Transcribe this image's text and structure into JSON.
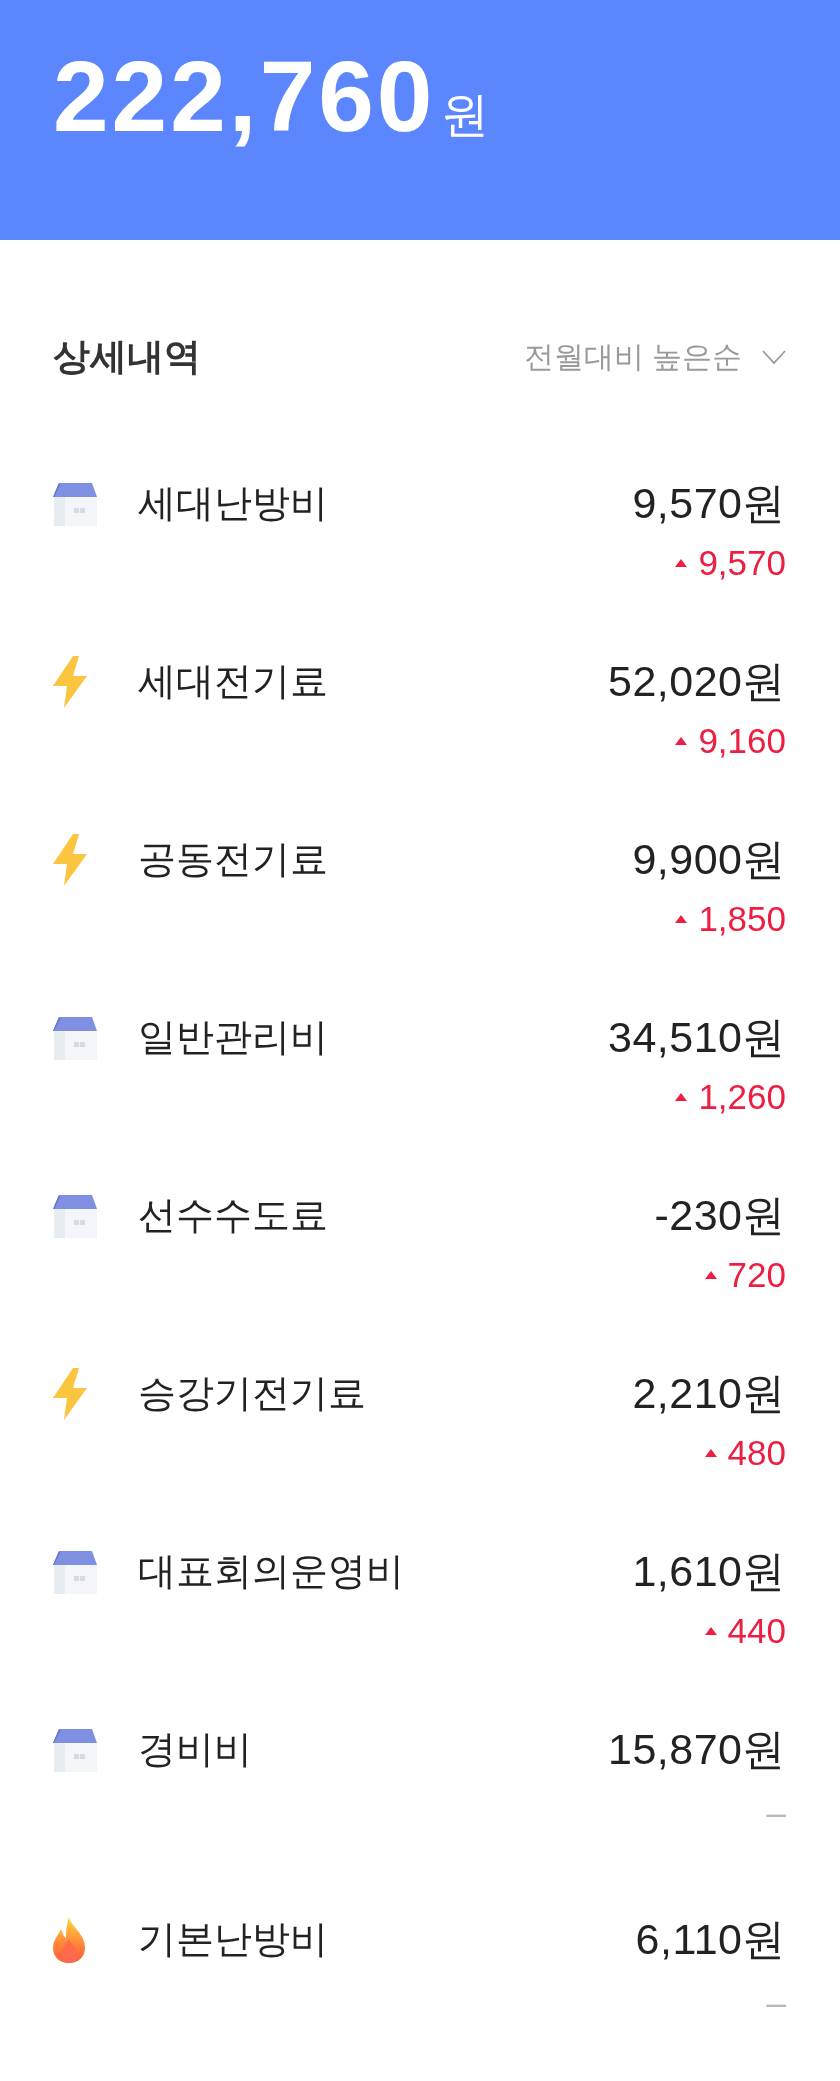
{
  "summary": {
    "amount": "222,760",
    "unit": "원"
  },
  "details": {
    "title": "상세내역",
    "sort": {
      "label": "전월대비 높은순"
    }
  },
  "items": [
    {
      "kind": "house",
      "name": "세대난방비",
      "amount": "9,570원",
      "increased": true,
      "change": "9,570"
    },
    {
      "kind": "bolt",
      "name": "세대전기료",
      "amount": "52,020원",
      "increased": true,
      "change": "9,160"
    },
    {
      "kind": "bolt",
      "name": "공동전기료",
      "amount": "9,900원",
      "increased": true,
      "change": "1,850"
    },
    {
      "kind": "house",
      "name": "일반관리비",
      "amount": "34,510원",
      "increased": true,
      "change": "1,260"
    },
    {
      "kind": "house",
      "name": "선수수도료",
      "amount": "-230원",
      "increased": true,
      "change": "720"
    },
    {
      "kind": "bolt",
      "name": "승강기전기료",
      "amount": "2,210원",
      "increased": true,
      "change": "480"
    },
    {
      "kind": "house",
      "name": "대표회의운영비",
      "amount": "1,610원",
      "increased": true,
      "change": "440"
    },
    {
      "kind": "house",
      "name": "경비비",
      "amount": "15,870원",
      "increased": false,
      "change": "–"
    },
    {
      "kind": "flame",
      "name": "기본난방비",
      "amount": "6,110원",
      "increased": false,
      "change": "–"
    }
  ]
}
